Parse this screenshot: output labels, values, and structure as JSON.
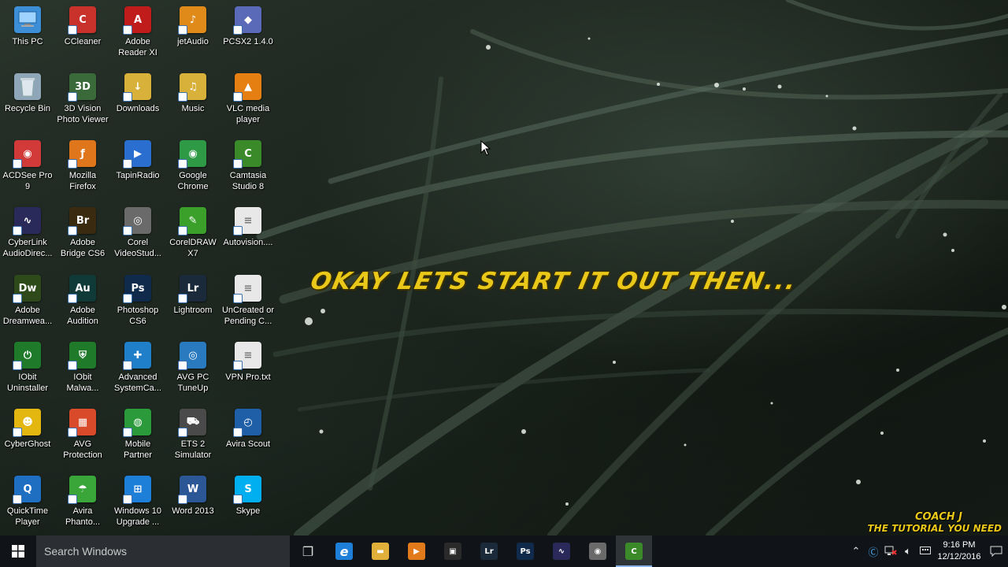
{
  "desktop": {
    "overlay_text": "OKAY LETS START IT OUT THEN...",
    "watermark_line1": "COACH J",
    "watermark_line2": "THE TUTORIAL YOU NEED",
    "icons": [
      {
        "label": "This PC",
        "glyph": "",
        "color": "#3c8fd6",
        "icon": "computer-icon"
      },
      {
        "label": "Recycle Bin",
        "glyph": "",
        "color": "#8fa6b8",
        "icon": "recycle-bin-icon"
      },
      {
        "label": "ACDSee Pro\n9",
        "glyph": "◉",
        "color": "#d23a3a",
        "icon": "acdsee-icon"
      },
      {
        "label": "CyberLink\nAudioDirec...",
        "glyph": "∿",
        "color": "#2a2a5a",
        "icon": "audiodirector-icon"
      },
      {
        "label": "Adobe\nDreamwea...",
        "glyph": "Dw",
        "color": "#2e4a1a",
        "icon": "dreamweaver-icon"
      },
      {
        "label": "IObit\nUninstaller",
        "glyph": "⏻",
        "color": "#1f7a2a",
        "icon": "iobit-uninstaller-icon"
      },
      {
        "label": "CyberGhost",
        "glyph": "☻",
        "color": "#e3b70f",
        "icon": "cyberghost-icon"
      },
      {
        "label": "QuickTime\nPlayer",
        "glyph": "Q",
        "color": "#1e6fc2",
        "icon": "quicktime-icon"
      },
      {
        "label": "CCleaner",
        "glyph": "C",
        "color": "#c8322b",
        "icon": "ccleaner-icon"
      },
      {
        "label": "3D Vision\nPhoto Viewer",
        "glyph": "3D",
        "color": "#3a6a3a",
        "icon": "3d-vision-icon"
      },
      {
        "label": "Mozilla\nFirefox",
        "glyph": "ƒ",
        "color": "#e0761b",
        "icon": "firefox-icon"
      },
      {
        "label": "Adobe\nBridge CS6",
        "glyph": "Br",
        "color": "#3a2a10",
        "icon": "bridge-icon"
      },
      {
        "label": "Adobe\nAudition",
        "glyph": "Au",
        "color": "#103a38",
        "icon": "audition-icon"
      },
      {
        "label": "IObit\nMalwa...",
        "glyph": "⛨",
        "color": "#1f7a2a",
        "icon": "iobit-malware-icon"
      },
      {
        "label": "AVG\nProtection",
        "glyph": "▦",
        "color": "#d94a2a",
        "icon": "avg-icon"
      },
      {
        "label": "Avira\nPhanto...",
        "glyph": "☂",
        "color": "#3aa63a",
        "icon": "avira-phantom-icon"
      },
      {
        "label": "Adobe\nReader XI",
        "glyph": "A",
        "color": "#c01c1c",
        "icon": "adobe-reader-icon"
      },
      {
        "label": "Downloads",
        "glyph": "↓",
        "color": "#d8b13a",
        "icon": "folder-icon"
      },
      {
        "label": "TapinRadio",
        "glyph": "▶",
        "color": "#2a6fd0",
        "icon": "tapinradio-icon"
      },
      {
        "label": "Corel\nVideoStud...",
        "glyph": "◎",
        "color": "#6a6a6a",
        "icon": "corel-videostudio-icon"
      },
      {
        "label": "Photoshop\nCS6",
        "glyph": "Ps",
        "color": "#0f2a4a",
        "icon": "photoshop-icon"
      },
      {
        "label": "Advanced\nSystemCa...",
        "glyph": "✚",
        "color": "#1f7fc8",
        "icon": "advanced-systemcare-icon"
      },
      {
        "label": "Mobile\nPartner",
        "glyph": "◍",
        "color": "#2a9a3a",
        "icon": "mobile-partner-icon"
      },
      {
        "label": "Windows 10\nUpgrade ...",
        "glyph": "⊞",
        "color": "#1e7fd8",
        "icon": "windows-upgrade-icon"
      },
      {
        "label": "jetAudio",
        "glyph": "♪",
        "color": "#e08a1a",
        "icon": "jetaudio-icon"
      },
      {
        "label": "Music",
        "glyph": "♫",
        "color": "#d8b13a",
        "icon": "music-folder-icon"
      },
      {
        "label": "Google\nChrome",
        "glyph": "◉",
        "color": "#2e9a46",
        "icon": "chrome-icon"
      },
      {
        "label": "CorelDRAW\nX7",
        "glyph": "✎",
        "color": "#3aa02a",
        "icon": "coreldraw-icon"
      },
      {
        "label": "Lightroom",
        "glyph": "Lr",
        "color": "#1a2a3a",
        "icon": "lightroom-icon"
      },
      {
        "label": "AVG PC\nTuneUp",
        "glyph": "◎",
        "color": "#2a7ac0",
        "icon": "avg-tuneup-icon"
      },
      {
        "label": "ETS 2\nSimulator",
        "glyph": "⛟",
        "color": "#4a4a4a",
        "icon": "ets2-icon"
      },
      {
        "label": "Word 2013",
        "glyph": "W",
        "color": "#2b5797",
        "icon": "word-icon"
      },
      {
        "label": "PCSX2 1.4.0",
        "glyph": "◆",
        "color": "#5a6ab8",
        "icon": "pcsx2-icon"
      },
      {
        "label": "VLC media\nplayer",
        "glyph": "▲",
        "color": "#e57f12",
        "icon": "vlc-icon"
      },
      {
        "label": "Camtasia\nStudio 8",
        "glyph": "C",
        "color": "#3a8a2a",
        "icon": "camtasia-icon"
      },
      {
        "label": "Autovision....",
        "glyph": "≡",
        "color": "#e8e8e8",
        "icon": "text-file-icon"
      },
      {
        "label": "UnCreated or\nPending C...",
        "glyph": "≡",
        "color": "#e8e8e8",
        "icon": "text-file-icon"
      },
      {
        "label": "VPN Pro.txt",
        "glyph": "≡",
        "color": "#e8e8e8",
        "icon": "text-file-icon"
      },
      {
        "label": "Avira Scout",
        "glyph": "◴",
        "color": "#1f5fa8",
        "icon": "avira-scout-icon"
      },
      {
        "label": "Skype",
        "glyph": "S",
        "color": "#00aff0",
        "icon": "skype-icon"
      }
    ]
  },
  "taskbar": {
    "search_placeholder": "Search Windows",
    "pinned": [
      {
        "name": "task-view-button",
        "glyph": "❐",
        "color": "transparent",
        "active": false
      },
      {
        "name": "edge-button",
        "glyph": "e",
        "color": "#1e7fd8",
        "active": false
      },
      {
        "name": "file-explorer-button",
        "glyph": "▬",
        "color": "#e0b03a",
        "active": false
      },
      {
        "name": "media-player-button",
        "glyph": "▶",
        "color": "#e07a1a",
        "active": false
      },
      {
        "name": "store-button",
        "glyph": "▣",
        "color": "#2a2a2a",
        "active": false
      },
      {
        "name": "lightroom-button",
        "glyph": "Lr",
        "color": "#1a2a3a",
        "active": false
      },
      {
        "name": "photoshop-button",
        "glyph": "Ps",
        "color": "#0f2a4a",
        "active": false
      },
      {
        "name": "audiodirector-button",
        "glyph": "∿",
        "color": "#2a2a5a",
        "active": false
      },
      {
        "name": "camera-button",
        "glyph": "◉",
        "color": "#6a6a6a",
        "active": false
      },
      {
        "name": "camtasia-button",
        "glyph": "C",
        "color": "#3a8a2a",
        "active": true
      }
    ],
    "tray": {
      "time": "9:16 PM",
      "date": "12/12/2016"
    }
  }
}
